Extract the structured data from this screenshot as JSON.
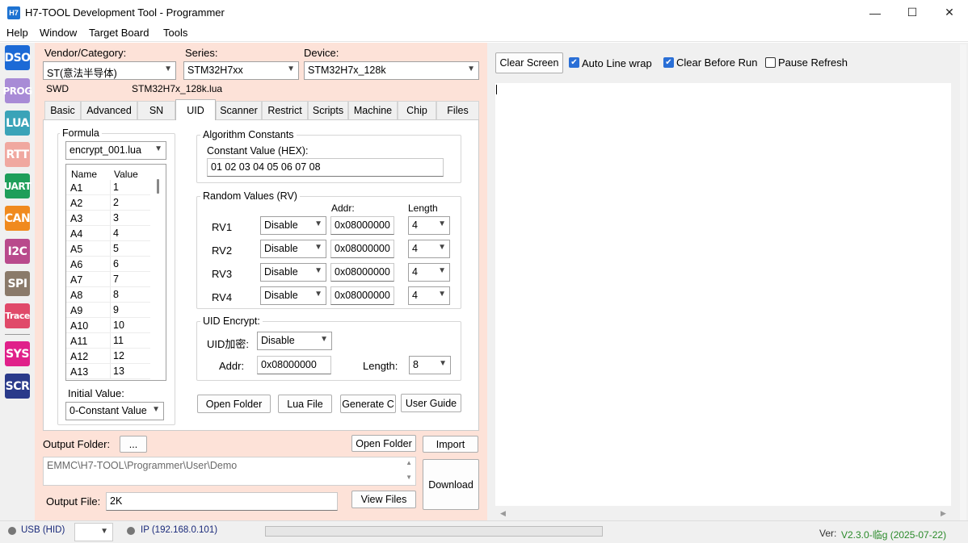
{
  "window": {
    "icon_text": "H7",
    "title": "H7-TOOL Development Tool - Programmer",
    "minimize": "—",
    "maximize": "☐",
    "close": "✕"
  },
  "menu": [
    "Help",
    "Window",
    "Target Board",
    "Tools"
  ],
  "sidebar": [
    {
      "label": "DSO",
      "color": "#1c6ad6"
    },
    {
      "label": "PROG",
      "color": "#a88bd6"
    },
    {
      "label": "LUA",
      "color": "#3aa3b8"
    },
    {
      "label": "RTT",
      "color": "#f0a8a0"
    },
    {
      "label": "UART",
      "color": "#1e9e5a"
    },
    {
      "label": "CAN",
      "color": "#f08a1e"
    },
    {
      "label": "I2C",
      "color": "#b94a8c"
    },
    {
      "label": "SPI",
      "color": "#8a7a6a"
    },
    {
      "label": "Trace",
      "color": "#e04a6a"
    },
    {
      "label": "SYS",
      "color": "#e0208a"
    },
    {
      "label": "SCR",
      "color": "#2a3a8a"
    }
  ],
  "selectors": {
    "vendor_label": "Vendor/Category:",
    "vendor_value": "ST(意法半导体)",
    "series_label": "Series:",
    "series_value": "STM32H7xx",
    "device_label": "Device:",
    "device_value": "STM32H7x_128k",
    "interface": "SWD",
    "lua_file": "STM32H7x_128k.lua"
  },
  "tabs": [
    "Basic",
    "Advanced",
    "SN",
    "UID",
    "Scanner",
    "Restrict",
    "Scripts",
    "Machine",
    "Chip",
    "Files"
  ],
  "active_tab": "UID",
  "formula": {
    "group_title": "Formula",
    "selected": "encrypt_001.lua",
    "columns": [
      "Name",
      "Value"
    ],
    "rows": [
      [
        "A1",
        "1"
      ],
      [
        "A2",
        "2"
      ],
      [
        "A3",
        "3"
      ],
      [
        "A4",
        "4"
      ],
      [
        "A5",
        "5"
      ],
      [
        "A6",
        "6"
      ],
      [
        "A7",
        "7"
      ],
      [
        "A8",
        "8"
      ],
      [
        "A9",
        "9"
      ],
      [
        "A10",
        "10"
      ],
      [
        "A11",
        "11"
      ],
      [
        "A12",
        "12"
      ],
      [
        "A13",
        "13"
      ]
    ],
    "initial_value_label": "Initial Value:",
    "initial_value": "0-Constant Value"
  },
  "algorithm": {
    "group_title": "Algorithm Constants",
    "constant_label": "Constant Value (HEX):",
    "constant_value": "01 02 03 04 05 06 07 08"
  },
  "random": {
    "group_title": "Random Values (RV)",
    "addr_header": "Addr:",
    "length_header": "Length",
    "rows": [
      {
        "name": "RV1",
        "mode": "Disable",
        "addr": "0x08000000",
        "length": "4"
      },
      {
        "name": "RV2",
        "mode": "Disable",
        "addr": "0x08000000",
        "length": "4"
      },
      {
        "name": "RV3",
        "mode": "Disable",
        "addr": "0x08000000",
        "length": "4"
      },
      {
        "name": "RV4",
        "mode": "Disable",
        "addr": "0x08000000",
        "length": "4"
      }
    ]
  },
  "uid_encrypt": {
    "group_title": "UID Encrypt:",
    "mode_label": "UID加密:",
    "mode_value": "Disable",
    "addr_label": "Addr:",
    "addr_value": "0x08000000",
    "length_label": "Length:",
    "length_value": "8"
  },
  "uid_buttons": {
    "open_folder": "Open Folder",
    "lua_file": "Lua File",
    "generate": "Generate C",
    "user_guide": "User Guide"
  },
  "output": {
    "folder_label": "Output Folder:",
    "browse": "...",
    "open_folder": "Open Folder",
    "import": "Import",
    "path": "EMMC\\H7-TOOL\\Programmer\\User\\Demo",
    "download": "Download",
    "file_label": "Output File:",
    "file_value": "2K",
    "view_files": "View Files"
  },
  "console": {
    "clear_screen": "Clear Screen",
    "auto_wrap": "Auto Line wrap",
    "clear_before_run": "Clear Before Run",
    "pause_refresh": "Pause Refresh"
  },
  "status": {
    "usb": "USB (HID)",
    "ip": "IP (192.168.0.101)",
    "version_label": "Ver:",
    "version_value": "V2.3.0-临g (2025-07-22)"
  }
}
